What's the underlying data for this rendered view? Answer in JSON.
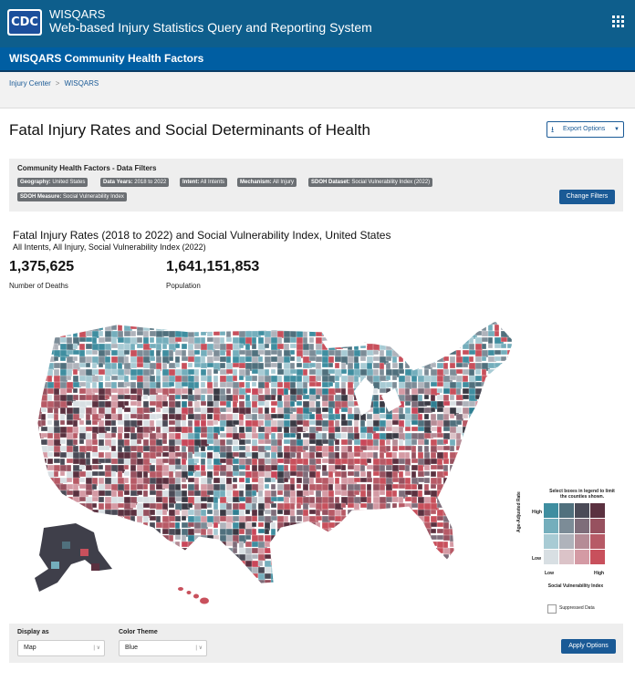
{
  "header": {
    "logo_text": "CDC",
    "app_title": "WISQARS",
    "app_subtitle": "Web-based Injury Statistics Query and Reporting System",
    "apps_icon": "grid-icon"
  },
  "section_bar": {
    "title": "WISQARS Community Health Factors"
  },
  "breadcrumb": {
    "items": [
      "Injury Center",
      "WISQARS"
    ],
    "separator": ">"
  },
  "page": {
    "title": "Fatal Injury Rates and Social Determinants of Health",
    "export_label": "Export Options",
    "export_icon": "download-icon"
  },
  "filters": {
    "title": "Community Health Factors - Data Filters",
    "chips": [
      {
        "key": "Geography:",
        "value": "United States"
      },
      {
        "key": "Data Years:",
        "value": "2018 to 2022"
      },
      {
        "key": "Intent:",
        "value": "All Intents"
      },
      {
        "key": "Mechanism:",
        "value": "All Injury"
      },
      {
        "key": "SDOH Dataset:",
        "value": "Social Vulnerability Index (2022)"
      },
      {
        "key": "SDOH Measure:",
        "value": "Social Vulnerability Index"
      }
    ],
    "change_label": "Change Filters"
  },
  "map": {
    "title": "Fatal Injury Rates (2018 to 2022) and Social Vulnerability Index, United States",
    "subtitle": "All Intents, All Injury, Social Vulnerability Index (2022)",
    "deaths_value": "1,375,625",
    "deaths_label": "Number of Deaths",
    "population_value": "1,641,151,853",
    "population_label": "Population"
  },
  "legend": {
    "note": "Select boxes in legend to limit the counties shown.",
    "y_label": "Age-Adjusted Rate",
    "y_high": "High",
    "y_low": "Low",
    "x_low": "Low",
    "x_high": "High",
    "x_title": "Social Vulnerability Index",
    "suppressed_label": "Suppressed Data",
    "colors": [
      [
        "#3f8ea0",
        "#50707d",
        "#4b4b57",
        "#5b3140"
      ],
      [
        "#74aebc",
        "#7c8c97",
        "#7e6d7a",
        "#97515f"
      ],
      [
        "#a8cbd4",
        "#afb3bb",
        "#b58c96",
        "#b75a66"
      ],
      [
        "#d8dfe3",
        "#dbc3c8",
        "#d49aa4",
        "#c8505c"
      ]
    ]
  },
  "controls": {
    "display_label": "Display as",
    "display_value": "Map",
    "theme_label": "Color Theme",
    "theme_value": "Blue",
    "apply_label": "Apply Options"
  }
}
